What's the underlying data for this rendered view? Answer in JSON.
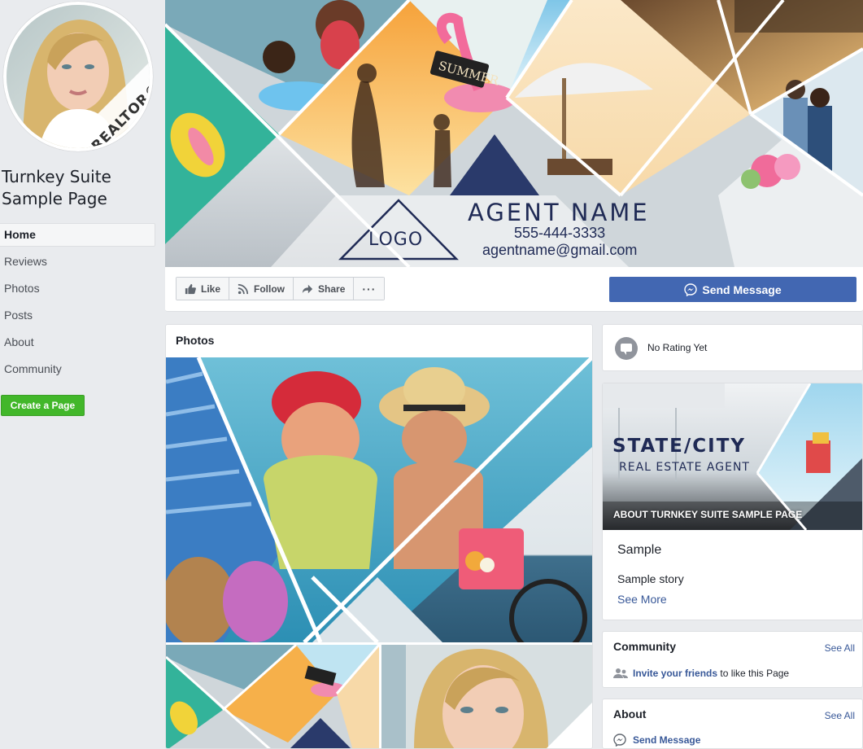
{
  "sidebar": {
    "page_name": "Turnkey Suite Sample Page",
    "realtor_badge": "REALTOR®",
    "nav": [
      {
        "label": "Home",
        "active": true
      },
      {
        "label": "Reviews"
      },
      {
        "label": "Photos"
      },
      {
        "label": "Posts"
      },
      {
        "label": "About"
      },
      {
        "label": "Community"
      }
    ],
    "create_page": "Create a Page"
  },
  "cover": {
    "summer_sign": "SUMMER",
    "logo": "LOGO",
    "agent_name": "AGENT NAME",
    "phone": "555-444-3333",
    "email": "agentname@gmail.com"
  },
  "actions": {
    "like": "Like",
    "follow": "Follow",
    "share": "Share",
    "more": "···",
    "send_message": "Send Message"
  },
  "photos": {
    "title": "Photos"
  },
  "rating": {
    "text": "No Rating Yet"
  },
  "about_card": {
    "state_city": "STATE/CITY",
    "real_estate_agent": "REAL ESTATE AGENT",
    "caption": "ABOUT TURNKEY SUITE SAMPLE PAGE",
    "heading": "Sample",
    "story": "Sample story",
    "see_more": "See More"
  },
  "community": {
    "title": "Community",
    "see_all": "See All",
    "invite_link": "Invite your friends",
    "invite_rest": "to like this Page"
  },
  "about_section": {
    "title": "About",
    "see_all": "See All",
    "send_message": "Send Message"
  },
  "colors": {
    "brand_blue": "#4267b2",
    "navy": "#1f2a55",
    "create_green": "#42b72a",
    "link": "#385898"
  }
}
